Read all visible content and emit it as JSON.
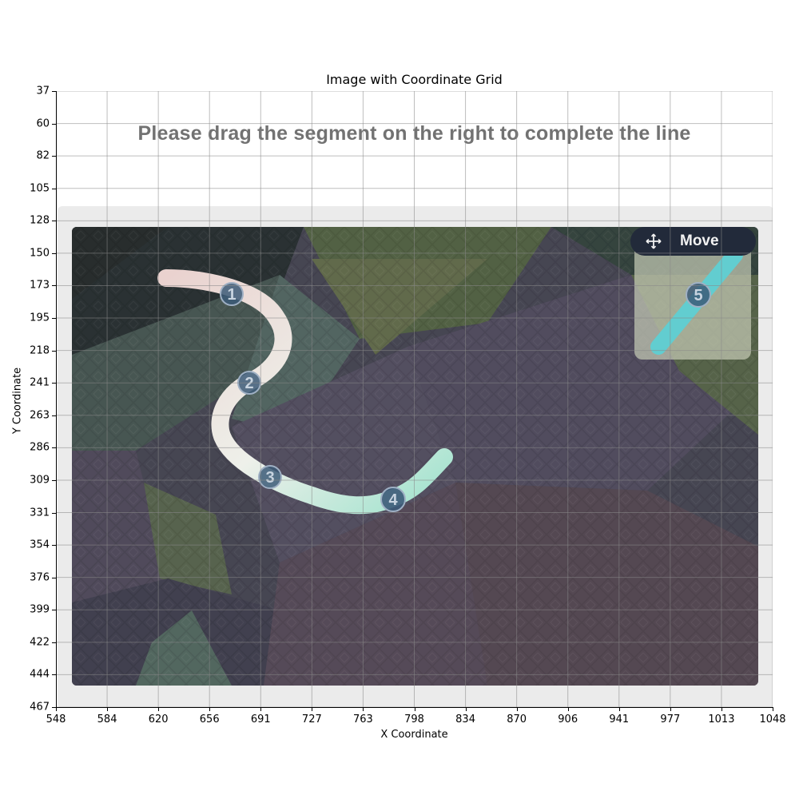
{
  "figure": {
    "title": "Image with Coordinate Grid",
    "xlabel": "X Coordinate",
    "ylabel": "Y Coordinate",
    "x_ticks": [
      "548",
      "584",
      "620",
      "656",
      "691",
      "727",
      "763",
      "798",
      "834",
      "870",
      "906",
      "941",
      "977",
      "1013",
      "1048"
    ],
    "y_ticks": [
      "37",
      "60",
      "82",
      "105",
      "128",
      "150",
      "173",
      "195",
      "218",
      "241",
      "263",
      "286",
      "309",
      "331",
      "354",
      "376",
      "399",
      "422",
      "444",
      "467"
    ]
  },
  "captcha": {
    "instruction": "Please drag the segment on the right to complete the line",
    "move_label": "Move",
    "markers": [
      "1",
      "2",
      "3",
      "4",
      "5"
    ],
    "colors": {
      "path_start": "#e8d2cc",
      "path_mid": "#f0f0ea",
      "path_end": "#9ee0cc",
      "segment": "#62cdd0",
      "marker_fill": "#3c5a78",
      "marker_text": "#c8d4e0",
      "background": "#4a4a55",
      "button": "#222a3a"
    },
    "icons": [
      "move-arrows-icon"
    ]
  }
}
